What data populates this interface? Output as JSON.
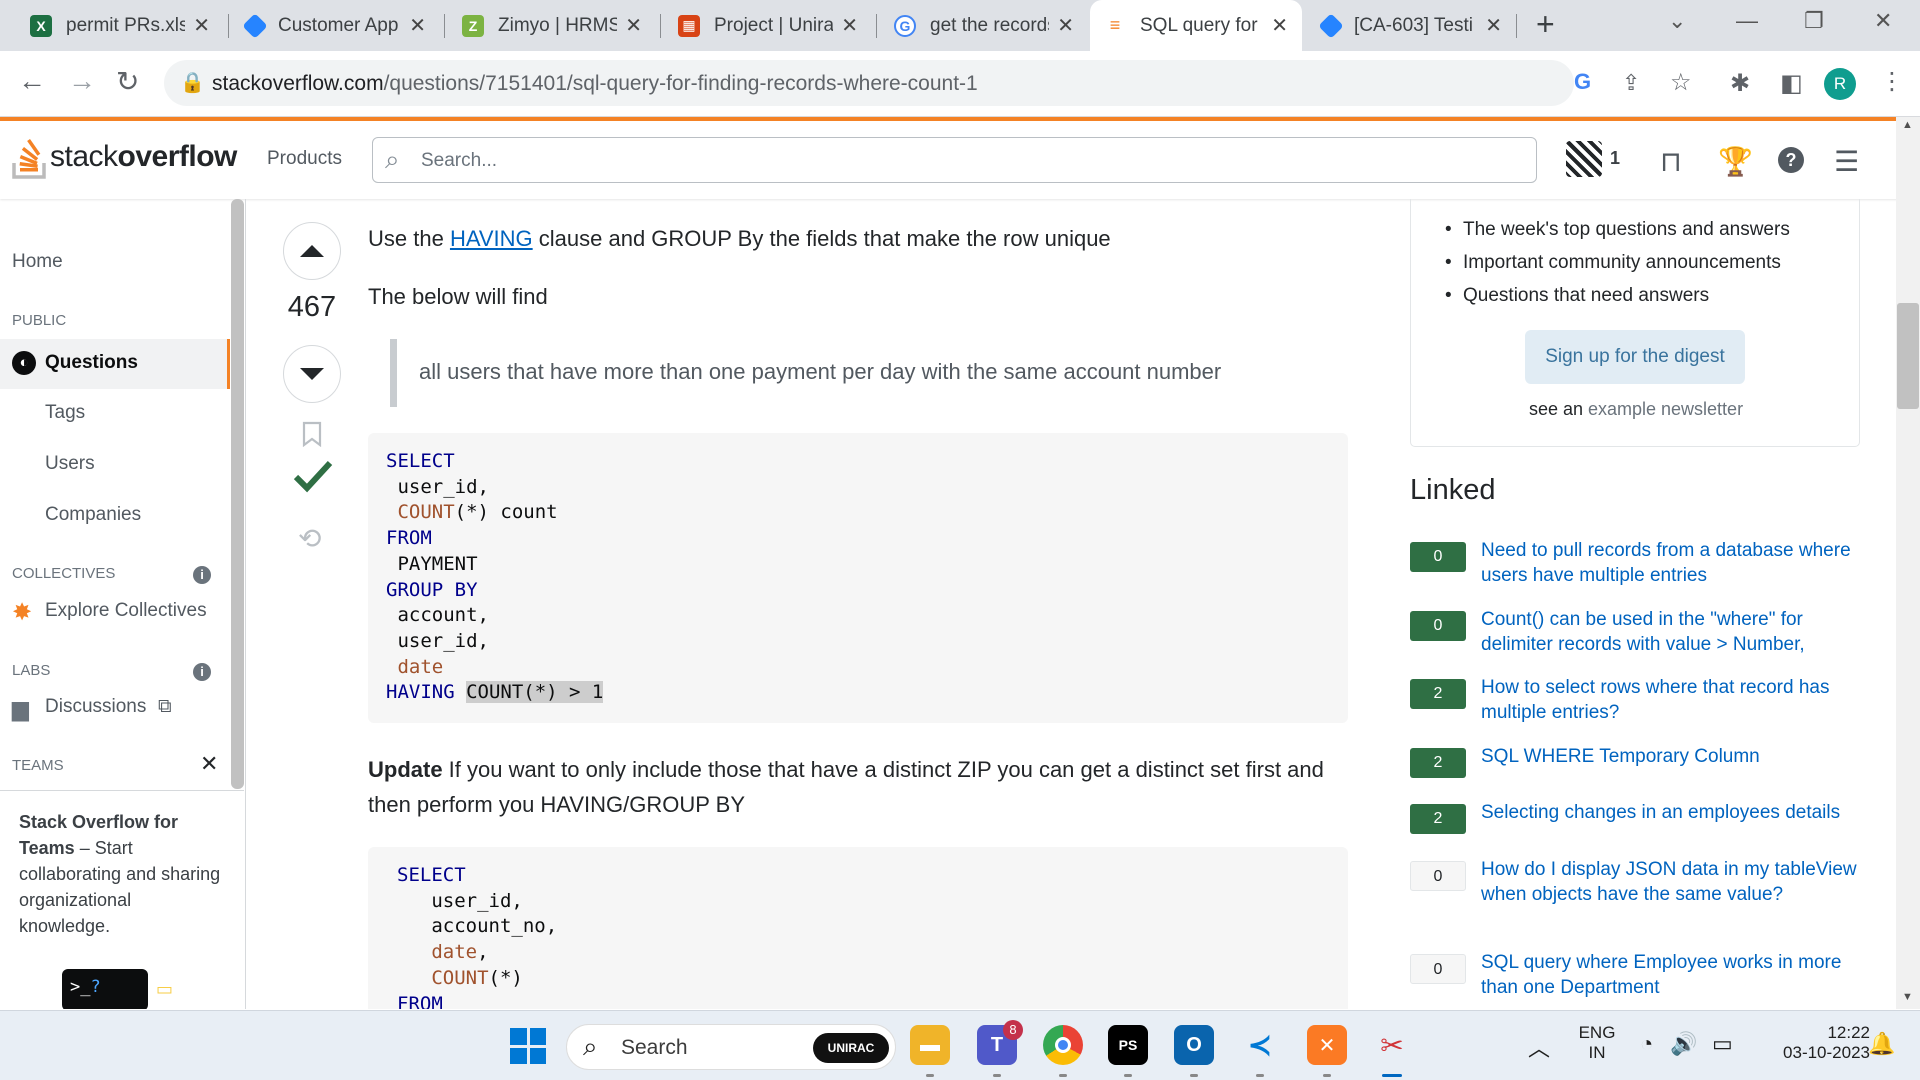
{
  "browser": {
    "tabs": [
      {
        "title": "permit PRs.xlsx",
        "favicon": "excel-icon",
        "color": "#1d6f42"
      },
      {
        "title": "Customer App",
        "favicon": "jira-icon",
        "color": "#2684ff"
      },
      {
        "title": "Zimyo | HRMS",
        "favicon": "zimyo-icon",
        "color": "#7cb342"
      },
      {
        "title": "Project | Unirac",
        "favicon": "unirac-icon",
        "color": "#d84315"
      },
      {
        "title": "get the records",
        "favicon": "google-icon",
        "color": "#4285f4"
      },
      {
        "title": "SQL query for",
        "favicon": "stackoverflow-icon",
        "color": "#f48225"
      },
      {
        "title": "[CA-603] Testi",
        "favicon": "jira-icon",
        "color": "#2684ff"
      }
    ],
    "url_host": "stackoverflow.com",
    "url_path": "/questions/7151401/sql-query-for-finding-records-where-count-1",
    "profile_initial": "R"
  },
  "so_header": {
    "logo_light": "stack",
    "logo_bold": "overflow",
    "products": "Products",
    "search_placeholder": "Search...",
    "achievements_count": "1"
  },
  "leftnav": {
    "home": "Home",
    "public": "PUBLIC",
    "questions": "Questions",
    "tags": "Tags",
    "users": "Users",
    "companies": "Companies",
    "collectives": "COLLECTIVES",
    "explore_collectives": "Explore Collectives",
    "labs": "LABS",
    "discussions": "Discussions",
    "teams": "TEAMS",
    "teams_promo_bold1": "Stack Overflow for Teams",
    "teams_promo_rest": " – Start collaborating and sharing organizational knowledge."
  },
  "answer": {
    "score": "467",
    "para1_pre": "Use the ",
    "para1_link": "HAVING",
    "para1_post": " clause and GROUP By the fields that make the row unique",
    "para2": "The below will find",
    "quote": "all users that have more than one payment per day with the same account number",
    "update_bold": "Update",
    "update_text": " If you want to only include those that have a distinct ZIP you can get a distinct set first and then perform you HAVING/GROUP BY",
    "code1": [
      {
        "parts": [
          {
            "t": "SELECT",
            "c": "kw"
          }
        ]
      },
      {
        "parts": [
          {
            "t": " user_id,",
            "c": ""
          }
        ]
      },
      {
        "parts": [
          {
            "t": " ",
            "c": ""
          },
          {
            "t": "COUNT",
            "c": "fn"
          },
          {
            "t": "(*) count",
            "c": ""
          }
        ]
      },
      {
        "parts": [
          {
            "t": "FROM",
            "c": "kw"
          }
        ]
      },
      {
        "parts": [
          {
            "t": " PAYMENT",
            "c": ""
          }
        ]
      },
      {
        "parts": [
          {
            "t": "GROUP BY",
            "c": "kw"
          }
        ]
      },
      {
        "parts": [
          {
            "t": " account,",
            "c": ""
          }
        ]
      },
      {
        "parts": [
          {
            "t": " user_id,",
            "c": ""
          }
        ]
      },
      {
        "parts": [
          {
            "t": " ",
            "c": ""
          },
          {
            "t": "date",
            "c": "fn"
          }
        ]
      },
      {
        "parts": [
          {
            "t": "HAVING",
            "c": "kw"
          },
          {
            "t": " ",
            "c": ""
          },
          {
            "t": "COUNT(*) > 1",
            "c": "hl"
          }
        ]
      }
    ],
    "code2": [
      {
        "parts": [
          {
            "t": "SELECT",
            "c": "kw"
          }
        ]
      },
      {
        "parts": [
          {
            "t": "   user_id,",
            "c": ""
          }
        ]
      },
      {
        "parts": [
          {
            "t": "   account_no,",
            "c": ""
          }
        ]
      },
      {
        "parts": [
          {
            "t": "   ",
            "c": ""
          },
          {
            "t": "date",
            "c": "fn"
          },
          {
            "t": ",",
            "c": ""
          }
        ]
      },
      {
        "parts": [
          {
            "t": "   ",
            "c": ""
          },
          {
            "t": "COUNT",
            "c": "fn"
          },
          {
            "t": "(*)",
            "c": ""
          }
        ]
      },
      {
        "parts": [
          {
            "t": "FROM",
            "c": "kw"
          }
        ]
      }
    ]
  },
  "digest": {
    "bullets": [
      "The week's top questions and answers",
      "Important community announcements",
      "Questions that need answers"
    ],
    "button": "Sign up for the digest",
    "see_an": "see an ",
    "example": "example newsletter"
  },
  "linked": {
    "title": "Linked",
    "items": [
      {
        "score": "0",
        "answered": true,
        "text": "Need to pull records from a database where users have multiple entries"
      },
      {
        "score": "0",
        "answered": true,
        "text": "Count() can be used in the \"where\" for delimiter records with value > Number,"
      },
      {
        "score": "2",
        "answered": true,
        "text": "How to select rows where that record has multiple entries?"
      },
      {
        "score": "2",
        "answered": true,
        "text": "SQL WHERE Temporary Column"
      },
      {
        "score": "2",
        "answered": true,
        "text": "Selecting changes in an employees details"
      },
      {
        "score": "0",
        "answered": false,
        "text": "How do I display JSON data in my tableView when objects have the same value?"
      },
      {
        "score": "0",
        "answered": false,
        "text": "SQL query where Employee works in more than one Department"
      }
    ]
  },
  "taskbar": {
    "search": "Search",
    "unirac_badge": "UNIRAC",
    "teams_badge": "8",
    "lang_top": "ENG",
    "lang_bottom": "IN",
    "time": "12:22",
    "date": "03-10-2023"
  }
}
